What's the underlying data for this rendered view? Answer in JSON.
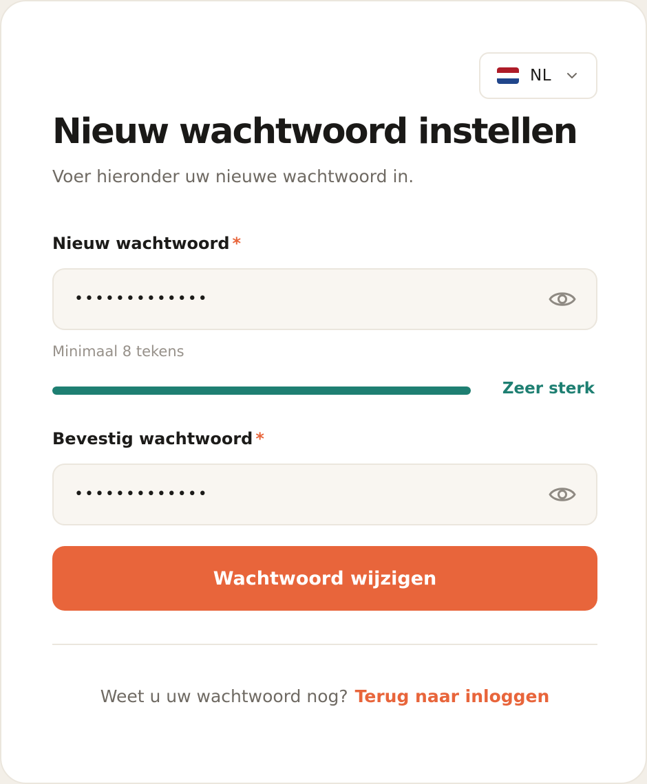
{
  "language": {
    "code": "NL",
    "flag_colors": [
      "#ae1c28",
      "#ffffff",
      "#21468b"
    ],
    "icon": "chevron-down-icon"
  },
  "page": {
    "title": "Nieuw wachtwoord instellen",
    "subtitle": "Voer hieronder uw nieuwe wachtwoord in."
  },
  "form": {
    "new_password": {
      "label": "Nieuw wachtwoord",
      "required_mark": "*",
      "value": "•••••••••••••",
      "toggle_icon": "eye-icon"
    },
    "hint": "Minimaal 8 tekens",
    "strength": {
      "label": "Zeer sterk",
      "level_fraction": 1.0,
      "color": "#1e7f72"
    },
    "confirm_password": {
      "label": "Bevestig wachtwoord",
      "required_mark": "*",
      "value": "•••••••••••••",
      "toggle_icon": "eye-icon"
    },
    "submit_label": "Wachtwoord wijzigen"
  },
  "footer": {
    "text": "Weet u uw wachtwoord nog?",
    "link": "Terug naar inloggen"
  },
  "colors": {
    "accent": "#e8653b",
    "success": "#1e7f72",
    "input_bg": "#f9f6f1",
    "border": "#ebe6dd"
  }
}
